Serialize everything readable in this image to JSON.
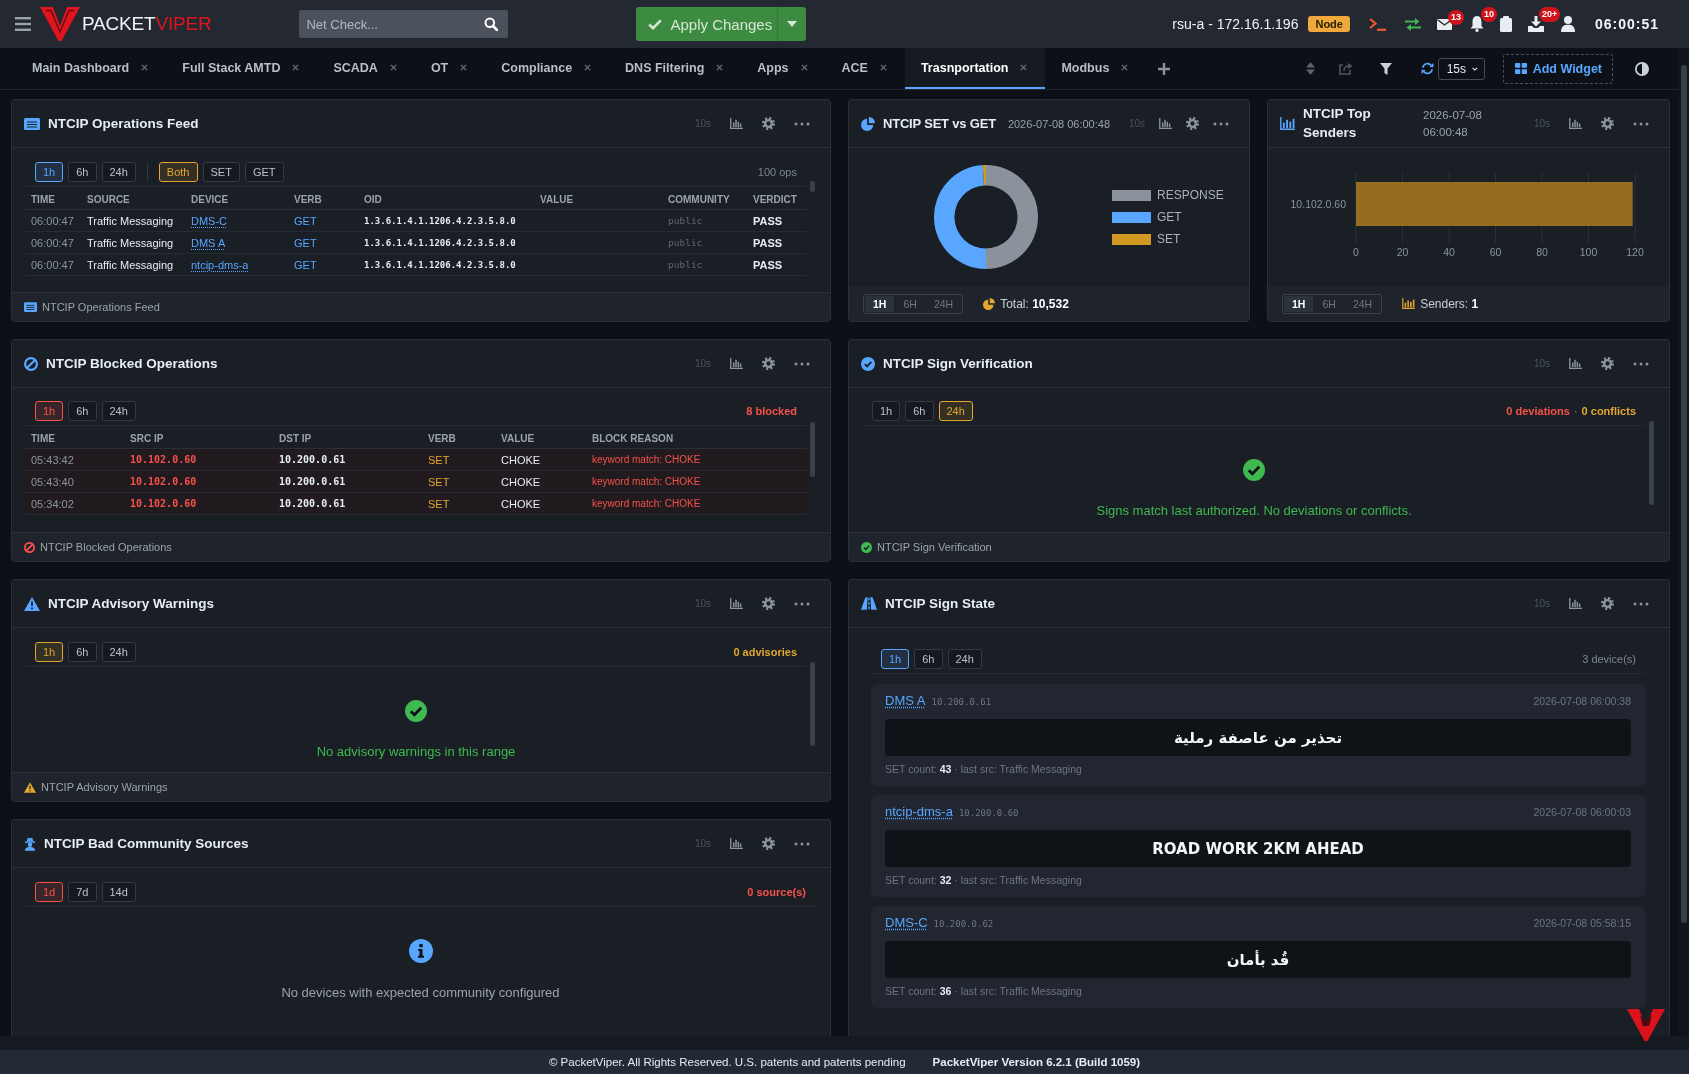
{
  "top_bar": {
    "logo": {
      "primary": "PACKET",
      "accent": "VIPER"
    },
    "search": {
      "placeholder": "Net Check..."
    },
    "apply_button": "Apply Changes",
    "host": "rsu-a - 172.16.1.196",
    "host_badge": "Node",
    "mail_count": "13",
    "alert_count": "10",
    "download_count": "20+",
    "clock": "06:00:51"
  },
  "tabs": [
    {
      "label": "Main Dashboard",
      "selected": false
    },
    {
      "label": "Full Stack AMTD",
      "selected": false
    },
    {
      "label": "SCADA",
      "selected": false
    },
    {
      "label": "OT",
      "selected": false
    },
    {
      "label": "Compliance",
      "selected": false
    },
    {
      "label": "DNS Filtering",
      "selected": false
    },
    {
      "label": "Apps",
      "selected": false
    },
    {
      "label": "ACE",
      "selected": false
    },
    {
      "label": "Trasnportation",
      "selected": true
    },
    {
      "label": "Modbus",
      "selected": false
    }
  ],
  "toolbar": {
    "refresh_interval": "15s",
    "add_widget": "Add Widget"
  },
  "widgets": [
    {
      "kind": "feed",
      "title": "NTCIP Operations Feed",
      "refresh": "10s",
      "filters": [
        {
          "color": "#58a6ff",
          "options": [
            {
              "label": "1h",
              "selected": true
            },
            {
              "label": "6h",
              "selected": false
            },
            {
              "label": "24h",
              "selected": false
            }
          ]
        },
        {
          "color": "#e3a72f",
          "options": [
            {
              "label": "Both",
              "selected": true
            },
            {
              "label": "SET",
              "selected": false
            },
            {
              "label": "GET",
              "selected": false
            }
          ]
        }
      ],
      "note": "100 ops",
      "columns": [
        "TIME",
        "SOURCE",
        "DEVICE",
        "VERB",
        "OID",
        "VALUE",
        "COMMUNITY",
        "VERDICT"
      ],
      "rows": [
        {
          "time": "06:00:47",
          "source": "Traffic Messaging",
          "device": "DMS-C",
          "verb": "GET",
          "oid": "1.3.6.1.4.1.1206.4.2.3.5.8.0",
          "community": "public",
          "verdict": "PASS"
        },
        {
          "time": "06:00:47",
          "source": "Traffic Messaging",
          "device": "DMS A",
          "verb": "GET",
          "oid": "1.3.6.1.4.1.1206.4.2.3.5.8.0",
          "community": "public",
          "verdict": "PASS"
        },
        {
          "time": "06:00:47",
          "source": "Traffic Messaging",
          "device": "ntcip-dms-a",
          "verb": "GET",
          "oid": "1.3.6.1.4.1.1206.4.2.3.5.8.0",
          "community": "public",
          "verdict": "PASS"
        }
      ],
      "footer": "NTCIP Operations Feed"
    },
    {
      "kind": "ratio",
      "title": "NTCIP SET vs GET",
      "timestamp": "2026-07-08 06:00:48",
      "refresh": "10s",
      "chart_data": {
        "type": "donut",
        "categories": [
          "RESPONSE",
          "GET",
          "SET"
        ],
        "values": [
          50,
          49,
          1
        ],
        "colors": [
          "#8b929b",
          "#58a6ff",
          "#d29922"
        ]
      },
      "segments": [
        {
          "label": "1H",
          "selected": true
        },
        {
          "label": "6H",
          "selected": false
        },
        {
          "label": "24H",
          "selected": false
        }
      ],
      "total": "Total: **10,532**"
    },
    {
      "kind": "senders",
      "title": "NTCIP Top Senders",
      "timestamp": "2026-07-08 06:00:48",
      "refresh": "10s",
      "chart_data": {
        "type": "bar",
        "orientation": "horizontal",
        "categories": [
          "10.102.0.60"
        ],
        "series": [
          {
            "color": "#946d22",
            "values": [
              119
            ]
          }
        ],
        "xlim": [
          0,
          120
        ],
        "xticks": [
          0,
          20,
          40,
          60,
          80,
          100,
          120
        ],
        "grid": true
      },
      "segments": [
        {
          "label": "1H",
          "selected": true
        },
        {
          "label": "6H",
          "selected": false
        },
        {
          "label": "24H",
          "selected": false
        }
      ],
      "total": "Senders: **1**"
    },
    {
      "kind": "blocked",
      "title": "NTCIP Blocked Operations",
      "refresh": "10s",
      "filters": [
        {
          "color": "#f85149",
          "options": [
            {
              "label": "1h",
              "selected": true
            },
            {
              "label": "6h",
              "selected": false
            },
            {
              "label": "24h",
              "selected": false
            }
          ]
        }
      ],
      "counts": [
        {
          "text": "8 blocked",
          "color": "#f85149"
        }
      ],
      "columns": [
        "TIME",
        "SRC IP",
        "DST IP",
        "VERB",
        "VALUE",
        "BLOCK REASON"
      ],
      "rows": [
        {
          "time": "05:43:42",
          "src_ip": "10.102.0.60",
          "dst_ip": "10.200.0.61",
          "verb": "SET",
          "value": "CHOKE",
          "reason": "keyword match: CHOKE"
        },
        {
          "time": "05:43:40",
          "src_ip": "10.102.0.60",
          "dst_ip": "10.200.0.61",
          "verb": "SET",
          "value": "CHOKE",
          "reason": "keyword match: CHOKE"
        },
        {
          "time": "05:34:02",
          "src_ip": "10.102.0.60",
          "dst_ip": "10.200.0.61",
          "verb": "SET",
          "value": "CHOKE",
          "reason": "keyword match: CHOKE"
        }
      ],
      "footer": "NTCIP Blocked Operations"
    },
    {
      "kind": "verification",
      "title": "NTCIP Sign Verification",
      "refresh": "10s",
      "filters": [
        {
          "color": "#e3a72f",
          "options": [
            {
              "label": "1h",
              "selected": false
            },
            {
              "label": "6h",
              "selected": false
            },
            {
              "label": "24h",
              "selected": true
            }
          ]
        }
      ],
      "counts": [
        {
          "text": "0 deviations",
          "color": "#f85149"
        },
        {
          "text": "0 conflicts",
          "color": "#e3a72f"
        }
      ],
      "separator": "·",
      "empty_message": "Signs match last authorized. No deviations or conflicts.",
      "footer": "NTCIP Sign Verification"
    },
    {
      "kind": "advisory",
      "title": "NTCIP Advisory Warnings",
      "refresh": "10s",
      "filters": [
        {
          "color": "#e3a72f",
          "options": [
            {
              "label": "1h",
              "selected": true
            },
            {
              "label": "6h",
              "selected": false
            },
            {
              "label": "24h",
              "selected": false
            }
          ]
        }
      ],
      "counts": [
        {
          "text": "0 advisories",
          "color": "#e3a72f"
        }
      ],
      "empty_message": "No advisory warnings in this range",
      "footer": "NTCIP Advisory Warnings"
    },
    {
      "kind": "community",
      "title": "NTCIP Bad Community Sources",
      "refresh": "10s",
      "filters": [
        {
          "color": "#f85149",
          "options": [
            {
              "label": "1d",
              "selected": true
            },
            {
              "label": "7d",
              "selected": false
            },
            {
              "label": "14d",
              "selected": false
            }
          ]
        }
      ],
      "counts": [
        {
          "text": "0 source(s)",
          "color": "#f85149"
        }
      ],
      "empty_message": "No devices with expected community configured"
    },
    {
      "kind": "signs",
      "title": "NTCIP Sign State",
      "refresh": "10s",
      "filters": [
        {
          "color": "#58a6ff",
          "options": [
            {
              "label": "1h",
              "selected": true
            },
            {
              "label": "6h",
              "selected": false
            },
            {
              "label": "24h",
              "selected": false
            }
          ]
        }
      ],
      "note": "3 device(s)",
      "signs": [
        {
          "device": "DMS A",
          "ip": "10.200.0.61",
          "timestamp": "2026-07-08 06:00:38",
          "message": "تحذير من عاصفة رملية",
          "meta": "SET count: **43** · last src: Traffic Messaging"
        },
        {
          "device": "ntcip-dms-a",
          "ip": "10.200.0.60",
          "timestamp": "2026-07-08 06:00:03",
          "message": "ROAD WORK 2KM AHEAD",
          "meta": "SET count: **32** · last src: Traffic Messaging"
        },
        {
          "device": "DMS-C",
          "ip": "10.200.0.62",
          "timestamp": "2026-07-08 05:58:15",
          "message": "قُد بأمان",
          "meta": "SET count: **36** · last src: Traffic Messaging"
        }
      ]
    }
  ],
  "footer": {
    "copyright": "© PacketViper. All Rights Reserved. U.S. patents and patents pending",
    "version": "PacketViper Version 6.2.1 (Build 1059)"
  }
}
